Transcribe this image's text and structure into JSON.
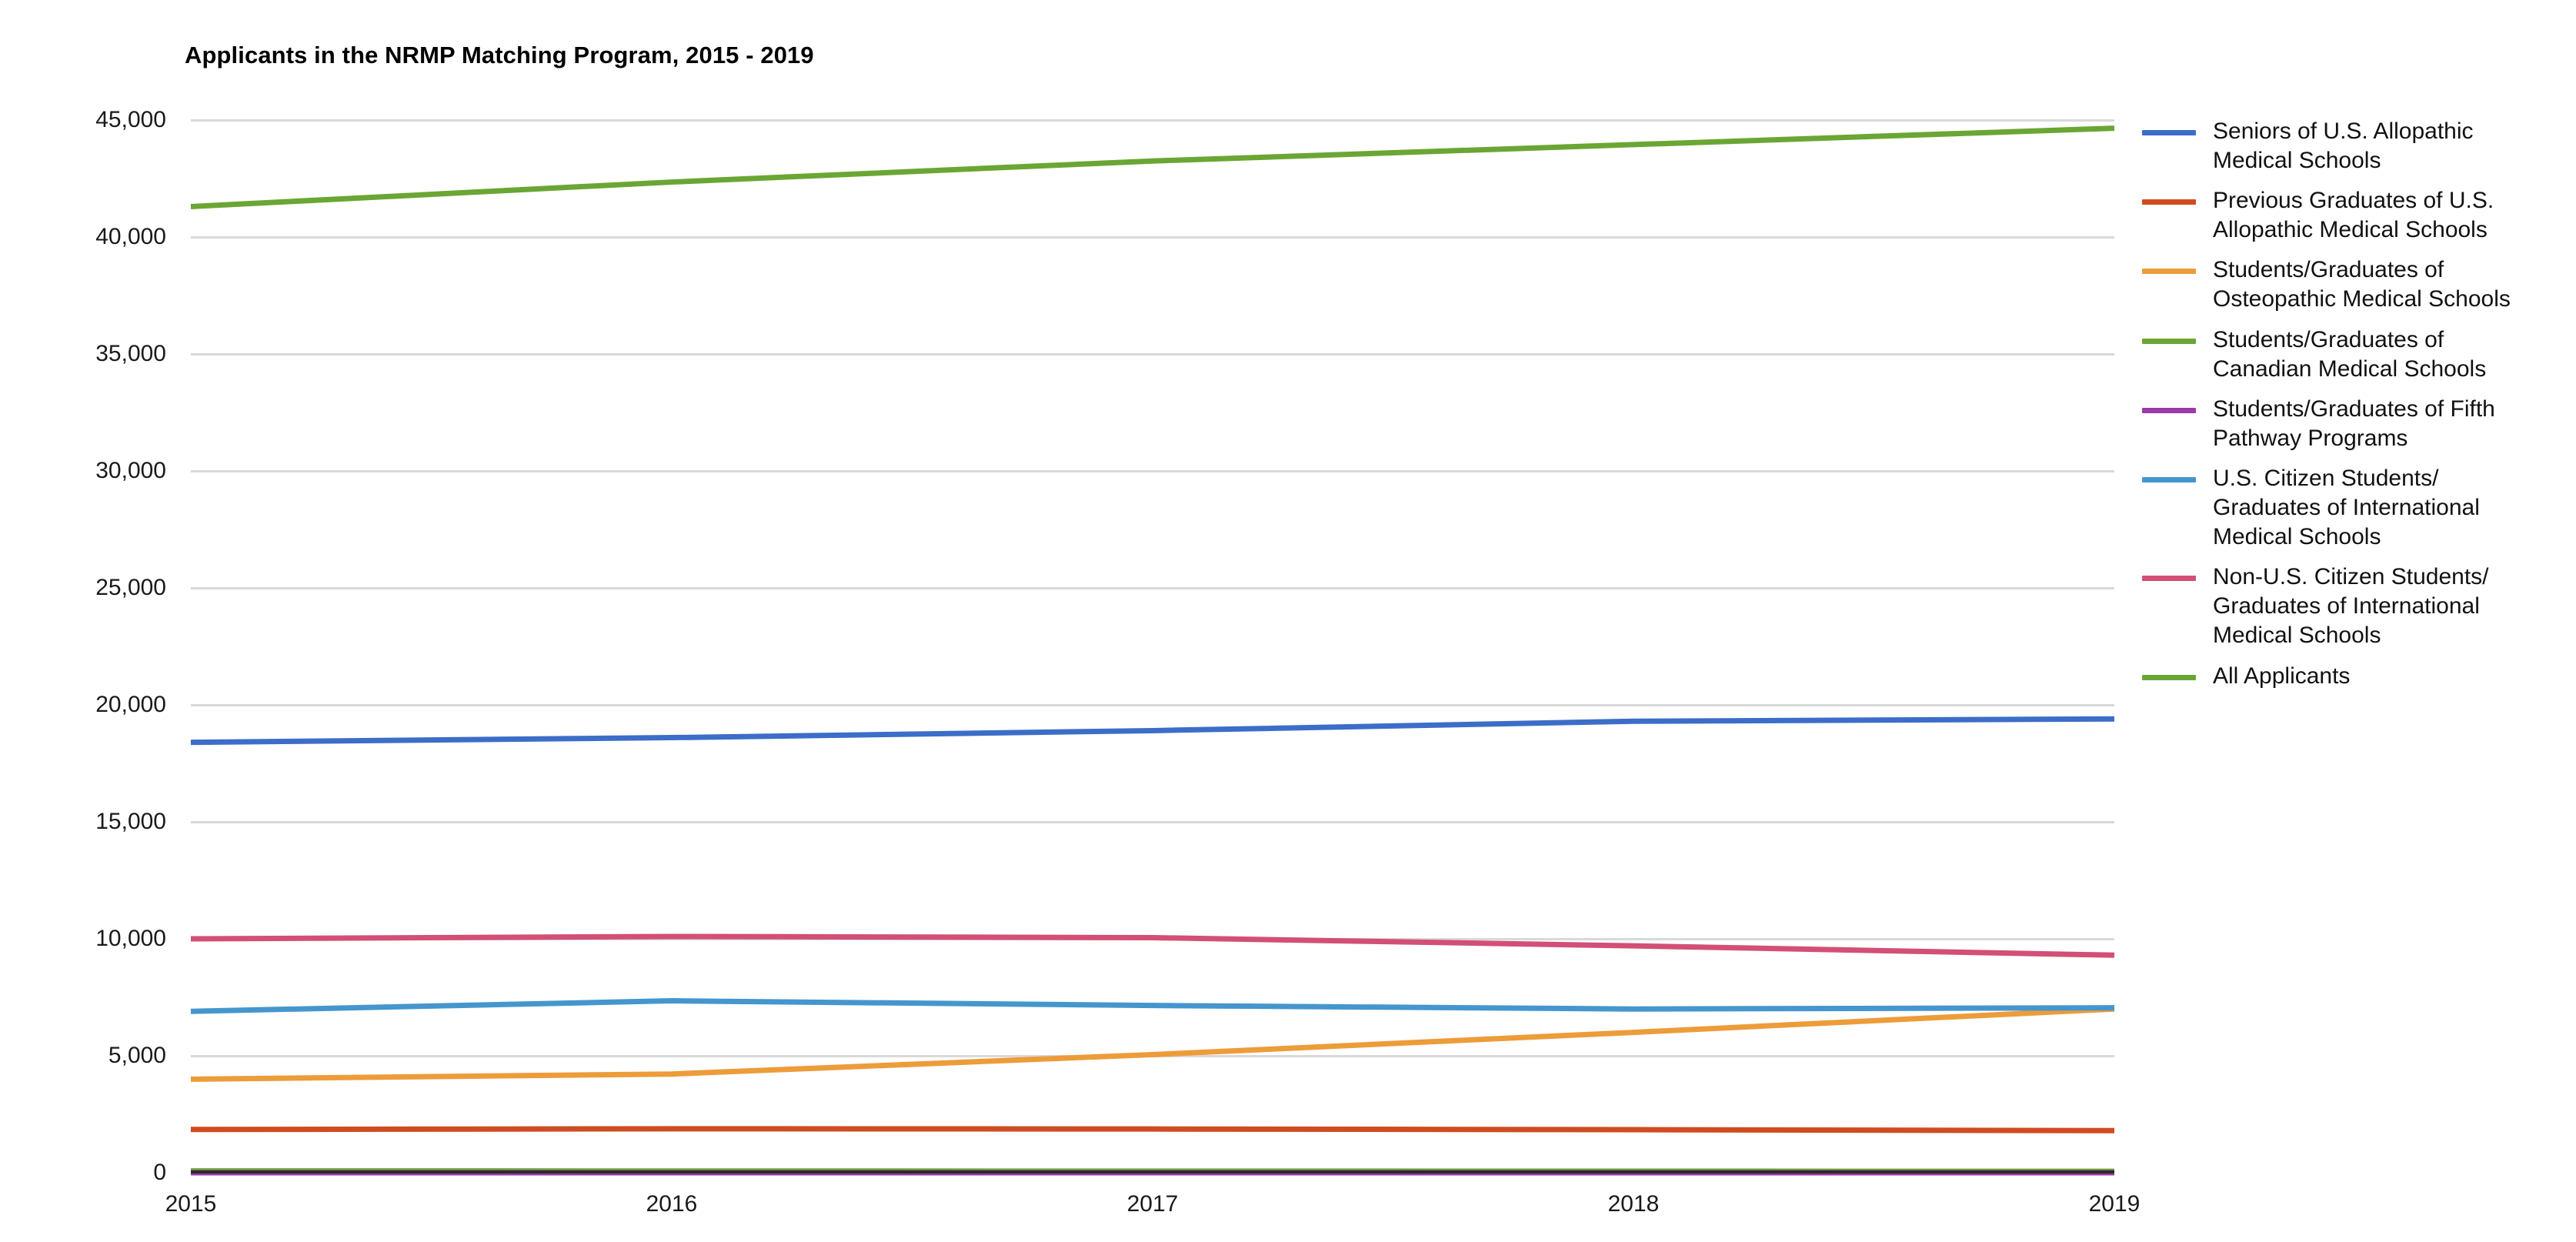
{
  "chart_data": {
    "type": "line",
    "title": "Applicants in the NRMP Matching Program, 2015 - 2019",
    "xlabel": "",
    "ylabel": "",
    "x": [
      2015,
      2016,
      2017,
      2018,
      2019
    ],
    "categories": [
      "2015",
      "2016",
      "2017",
      "2018",
      "2019"
    ],
    "ylim": [
      0,
      45000
    ],
    "ytick_labels": [
      "0",
      "5,000",
      "10,000",
      "15,000",
      "20,000",
      "25,000",
      "30,000",
      "35,000",
      "40,000",
      "45,000"
    ],
    "ytick_values": [
      0,
      5000,
      10000,
      15000,
      20000,
      25000,
      30000,
      35000,
      40000,
      45000
    ],
    "grid": true,
    "legend_position": "right",
    "series": [
      {
        "name": "Seniors of U.S. Allopathic Medical Schools",
        "color": "#3c6dc8",
        "values": [
          18400,
          18600,
          18900,
          19300,
          19400
        ]
      },
      {
        "name": "Previous Graduates of U.S. Allopathic Medical Schools",
        "color": "#cf4c21",
        "values": [
          1850,
          1880,
          1870,
          1840,
          1800
        ]
      },
      {
        "name": "Students/Graduates of Osteopathic Medical Schools",
        "color": "#ed9c3a",
        "values": [
          4000,
          4220,
          5050,
          6000,
          7000
        ]
      },
      {
        "name": "Students/Graduates of Canadian Medical Schools",
        "color": "#6aa634",
        "values": [
          80,
          75,
          70,
          65,
          60
        ]
      },
      {
        "name": "Students/Graduates of Fifth Pathway Programs",
        "color": "#9b3aa8",
        "values": [
          0,
          0,
          0,
          0,
          0
        ]
      },
      {
        "name": "U.S. Citizen Students/Graduates of International Medical Schools",
        "color": "#4596ce",
        "values": [
          6900,
          7350,
          7150,
          7000,
          7050
        ]
      },
      {
        "name": "Non-U.S. Citizen Students/Graduates of International Medical Schools",
        "color": "#d24f76",
        "values": [
          10000,
          10100,
          10050,
          9700,
          9300
        ]
      },
      {
        "name": "All Applicants",
        "color": "#6aa634",
        "values": [
          41300,
          42350,
          43250,
          43950,
          44650
        ]
      }
    ]
  },
  "legend": {
    "items": [
      {
        "label": "Seniors of U.S. Allopathic\nMedical Schools",
        "color": "#3c6dc8"
      },
      {
        "label": "Previous Graduates of U.S.\nAllopathic Medical Schools",
        "color": "#cf4c21"
      },
      {
        "label": "Students/Graduates of\nOsteopathic Medical Schools",
        "color": "#ed9c3a"
      },
      {
        "label": "Students/Graduates of\nCanadian Medical Schools",
        "color": "#6aa634"
      },
      {
        "label": "Students/Graduates of Fifth\nPathway Programs",
        "color": "#9b3aa8"
      },
      {
        "label": "U.S. Citizen Students/\nGraduates of International\nMedical Schools",
        "color": "#4596ce"
      },
      {
        "label": "Non-U.S. Citizen Students/\nGraduates of International\nMedical Schools",
        "color": "#d24f76"
      },
      {
        "label": "All Applicants",
        "color": "#6aa634"
      }
    ]
  }
}
